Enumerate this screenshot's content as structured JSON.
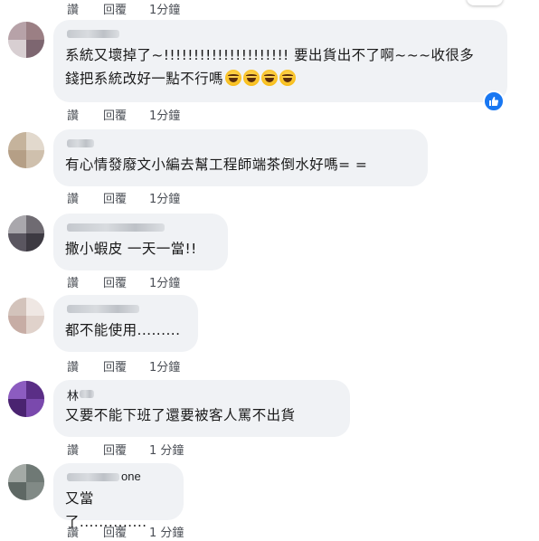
{
  "labels": {
    "like": "讚",
    "reply": "回覆"
  },
  "top_fragment": {
    "time": "1分鐘"
  },
  "comments": [
    {
      "author": "",
      "text": "系統又壞掉了~!!!!!!!!!!!!!!!!!!!!! 要出貨出不了啊~~~收很多\n錢把系統改好一點不行嗎",
      "emoji": [
        "laughing-tears-emoji",
        "laughing-tears-emoji",
        "laughing-tears-emoji",
        "laughing-tears-emoji"
      ],
      "time": "1分鐘",
      "reaction": "like"
    },
    {
      "author": "",
      "text": "有心情發廢文小編去幫工程師端茶倒水好嗎= =",
      "time": "1分鐘"
    },
    {
      "author": "",
      "text": "撒小蝦皮 一天一當!!",
      "time": "1分鐘"
    },
    {
      "author": "",
      "text": "都不能使用.........",
      "time": "1分鐘"
    },
    {
      "author": "林",
      "text": "又要不能下班了還要被客人罵不出貨",
      "time": "1 分鐘"
    },
    {
      "author": "one",
      "text": "又當了..............",
      "time": "1 分鐘"
    }
  ],
  "colors": {
    "bubble": "#f0f2f5",
    "meta": "#4b4f56",
    "like_badge": "#1877f2"
  }
}
